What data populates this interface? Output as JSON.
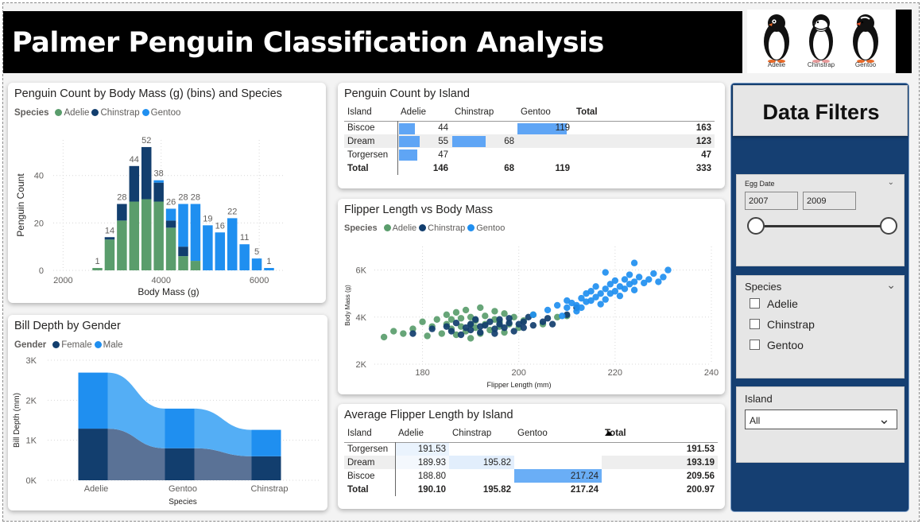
{
  "title": "Palmer Penguin Classification Analysis",
  "logos": [
    {
      "icon": "adelie-penguin-icon",
      "label": "Adelie"
    },
    {
      "icon": "chinstrap-penguin-icon",
      "label": "Chinstrap"
    },
    {
      "icon": "gentoo-penguin-icon",
      "label": "Gentoo"
    }
  ],
  "colors": {
    "adelie": "#5a9d6c",
    "chinstrap": "#123e6e",
    "gentoo": "#1f8ff0",
    "female": "#123e6e",
    "male": "#1f8ff0",
    "panel": "#153f72"
  },
  "histogram": {
    "title": "Penguin Count by Body Mass (g) (bins) and Species",
    "legend_title": "Species",
    "legend": [
      "Adelie",
      "Chinstrap",
      "Gentoo"
    ]
  },
  "bill": {
    "title": "Bill Depth by Gender",
    "legend_title": "Gender",
    "legend": [
      "Female",
      "Male"
    ]
  },
  "island_count": {
    "title": "Penguin Count by Island",
    "headers": [
      "Island",
      "Adelie",
      "Chinstrap",
      "Gentoo",
      "Total"
    ],
    "rows": [
      {
        "island": "Biscoe",
        "adelie": "44",
        "chinstrap": "",
        "gentoo": "119",
        "total": "163"
      },
      {
        "island": "Dream",
        "adelie": "55",
        "chinstrap": "68",
        "gentoo": "",
        "total": "123"
      },
      {
        "island": "Torgersen",
        "adelie": "47",
        "chinstrap": "",
        "gentoo": "",
        "total": "47"
      }
    ],
    "total": {
      "island": "Total",
      "adelie": "146",
      "chinstrap": "68",
      "gentoo": "119",
      "total": "333"
    }
  },
  "scatter": {
    "title": "Flipper Length vs Body Mass",
    "legend_title": "Species",
    "legend": [
      "Adelie",
      "Chinstrap",
      "Gentoo"
    ]
  },
  "avg_flipper": {
    "title": "Average Flipper Length by Island",
    "headers": [
      "Island",
      "Adelie",
      "Chinstrap",
      "Gentoo",
      "Total"
    ],
    "rows": [
      {
        "island": "Torgersen",
        "adelie": "191.53",
        "chinstrap": "",
        "gentoo": "",
        "total": "191.53"
      },
      {
        "island": "Dream",
        "adelie": "189.93",
        "chinstrap": "195.82",
        "gentoo": "",
        "total": "193.19"
      },
      {
        "island": "Biscoe",
        "adelie": "188.80",
        "chinstrap": "",
        "gentoo": "217.24",
        "total": "209.56"
      }
    ],
    "total": {
      "island": "Total",
      "adelie": "190.10",
      "chinstrap": "195.82",
      "gentoo": "217.24",
      "total": "200.97"
    }
  },
  "filters": {
    "header": "Data Filters",
    "egg_date": {
      "label": "Egg Date",
      "from": "2007",
      "to": "2009"
    },
    "species": {
      "label": "Species",
      "options": [
        "Adelie",
        "Chinstrap",
        "Gentoo"
      ]
    },
    "island": {
      "label": "Island",
      "selected": "All"
    }
  },
  "chart_data": [
    {
      "type": "bar",
      "title": "Penguin Count by Body Mass (g) (bins) and Species",
      "xlabel": "Body Mass (g)",
      "ylabel": "Penguin Count",
      "xlim": [
        1800,
        6500
      ],
      "ylim": [
        0,
        55
      ],
      "xticks": [
        "2000",
        "4000",
        "6000"
      ],
      "yticks": [
        "0",
        "20",
        "40"
      ],
      "bins": [
        2700,
        2950,
        3200,
        3450,
        3700,
        3950,
        4200,
        4450,
        4700,
        4950,
        5200,
        5450,
        5700,
        5950,
        6200
      ],
      "series": [
        {
          "name": "Adelie",
          "values": [
            1,
            13,
            21,
            29,
            30,
            29,
            18,
            6,
            4,
            0,
            0,
            0,
            0,
            0,
            0
          ]
        },
        {
          "name": "Chinstrap",
          "values": [
            0,
            1,
            7,
            15,
            22,
            8,
            3,
            4,
            0,
            0,
            0,
            0,
            0,
            0,
            0
          ]
        },
        {
          "name": "Gentoo",
          "values": [
            0,
            0,
            0,
            0,
            0,
            1,
            5,
            18,
            24,
            19,
            16,
            22,
            11,
            5,
            1
          ]
        }
      ],
      "totals": [
        1,
        14,
        28,
        44,
        52,
        38,
        26,
        28,
        28,
        19,
        16,
        22,
        11,
        5,
        1
      ]
    },
    {
      "type": "area",
      "title": "Bill Depth by Gender",
      "xlabel": "Species",
      "ylabel": "Bill Depth (mm)",
      "categories": [
        "Adelie",
        "Gentoo",
        "Chinstrap"
      ],
      "yticks": [
        "0K",
        "1K",
        "2K",
        "3K"
      ],
      "ylim": [
        0,
        3000
      ],
      "series": [
        {
          "name": "Female",
          "values": [
            1290,
            800,
            600
          ]
        },
        {
          "name": "Male",
          "values": [
            1400,
            990,
            660
          ]
        }
      ]
    },
    {
      "type": "scatter",
      "title": "Flipper Length vs Body Mass",
      "xlabel": "Flipper Length (mm)",
      "ylabel": "Body Mass (g)",
      "xlim": [
        170,
        240
      ],
      "ylim": [
        2000,
        7000
      ],
      "xticks": [
        "180",
        "200",
        "220",
        "240"
      ],
      "yticks": [
        "2K",
        "4K",
        "6K"
      ],
      "series": [
        {
          "name": "Adelie",
          "points": [
            [
              172,
              3150
            ],
            [
              174,
              3400
            ],
            [
              176,
              3300
            ],
            [
              178,
              3500
            ],
            [
              180,
              3800
            ],
            [
              181,
              3200
            ],
            [
              182,
              3600
            ],
            [
              183,
              3900
            ],
            [
              184,
              3300
            ],
            [
              185,
              3700
            ],
            [
              185,
              4100
            ],
            [
              186,
              3500
            ],
            [
              186,
              3900
            ],
            [
              187,
              3250
            ],
            [
              187,
              4200
            ],
            [
              188,
              3600
            ],
            [
              188,
              3950
            ],
            [
              189,
              3400
            ],
            [
              189,
              4300
            ],
            [
              190,
              3700
            ],
            [
              190,
              3100
            ],
            [
              190,
              4000
            ],
            [
              191,
              3550
            ],
            [
              191,
              3850
            ],
            [
              192,
              3300
            ],
            [
              192,
              4400
            ],
            [
              193,
              3700
            ],
            [
              193,
              4050
            ],
            [
              194,
              3450
            ],
            [
              195,
              3900
            ],
            [
              195,
              4250
            ],
            [
              196,
              3600
            ],
            [
              196,
              3800
            ],
            [
              197,
              3350
            ],
            [
              197,
              4150
            ],
            [
              198,
              3700
            ],
            [
              199,
              4000
            ],
            [
              200,
              3550
            ],
            [
              201,
              3850
            ],
            [
              203,
              4100
            ],
            [
              205,
              3700
            ],
            [
              208,
              4000
            ],
            [
              210,
              4050
            ]
          ]
        },
        {
          "name": "Chinstrap",
          "points": [
            [
              178,
              3300
            ],
            [
              182,
              3500
            ],
            [
              185,
              3600
            ],
            [
              186,
              3400
            ],
            [
              187,
              3750
            ],
            [
              188,
              3250
            ],
            [
              189,
              3550
            ],
            [
              190,
              3700
            ],
            [
              190,
              3450
            ],
            [
              191,
              3900
            ],
            [
              192,
              3600
            ],
            [
              192,
              3350
            ],
            [
              193,
              3650
            ],
            [
              194,
              3800
            ],
            [
              195,
              3500
            ],
            [
              195,
              3300
            ],
            [
              196,
              3900
            ],
            [
              196,
              3700
            ],
            [
              197,
              3550
            ],
            [
              198,
              3750
            ],
            [
              198,
              3950
            ],
            [
              199,
              3400
            ],
            [
              200,
              3700
            ],
            [
              201,
              3800
            ],
            [
              201,
              3550
            ],
            [
              202,
              4000
            ],
            [
              203,
              3650
            ],
            [
              205,
              3800
            ],
            [
              206,
              3950
            ],
            [
              207,
              3700
            ],
            [
              210,
              4100
            ],
            [
              212,
              4400
            ]
          ]
        },
        {
          "name": "Gentoo",
          "points": [
            [
              203,
              4100
            ],
            [
              206,
              4300
            ],
            [
              208,
              4500
            ],
            [
              209,
              4050
            ],
            [
              210,
              4400
            ],
            [
              210,
              4700
            ],
            [
              211,
              4600
            ],
            [
              212,
              4500
            ],
            [
              212,
              4250
            ],
            [
              213,
              4800
            ],
            [
              213,
              4400
            ],
            [
              214,
              4650
            ],
            [
              214,
              5000
            ],
            [
              215,
              4700
            ],
            [
              215,
              5100
            ],
            [
              216,
              4850
            ],
            [
              216,
              5300
            ],
            [
              217,
              5000
            ],
            [
              217,
              4550
            ],
            [
              218,
              5200
            ],
            [
              218,
              4750
            ],
            [
              219,
              5400
            ],
            [
              219,
              5000
            ],
            [
              220,
              5100
            ],
            [
              220,
              5550
            ],
            [
              221,
              5300
            ],
            [
              221,
              4900
            ],
            [
              222,
              5600
            ],
            [
              222,
              5200
            ],
            [
              223,
              5400
            ],
            [
              223,
              5800
            ],
            [
              224,
              5500
            ],
            [
              224,
              5150
            ],
            [
              225,
              5700
            ],
            [
              226,
              5450
            ],
            [
              227,
              5600
            ],
            [
              228,
              5850
            ],
            [
              229,
              5500
            ],
            [
              230,
              5700
            ],
            [
              231,
              6000
            ],
            [
              224,
              6300
            ],
            [
              218,
              5900
            ]
          ]
        }
      ]
    }
  ]
}
